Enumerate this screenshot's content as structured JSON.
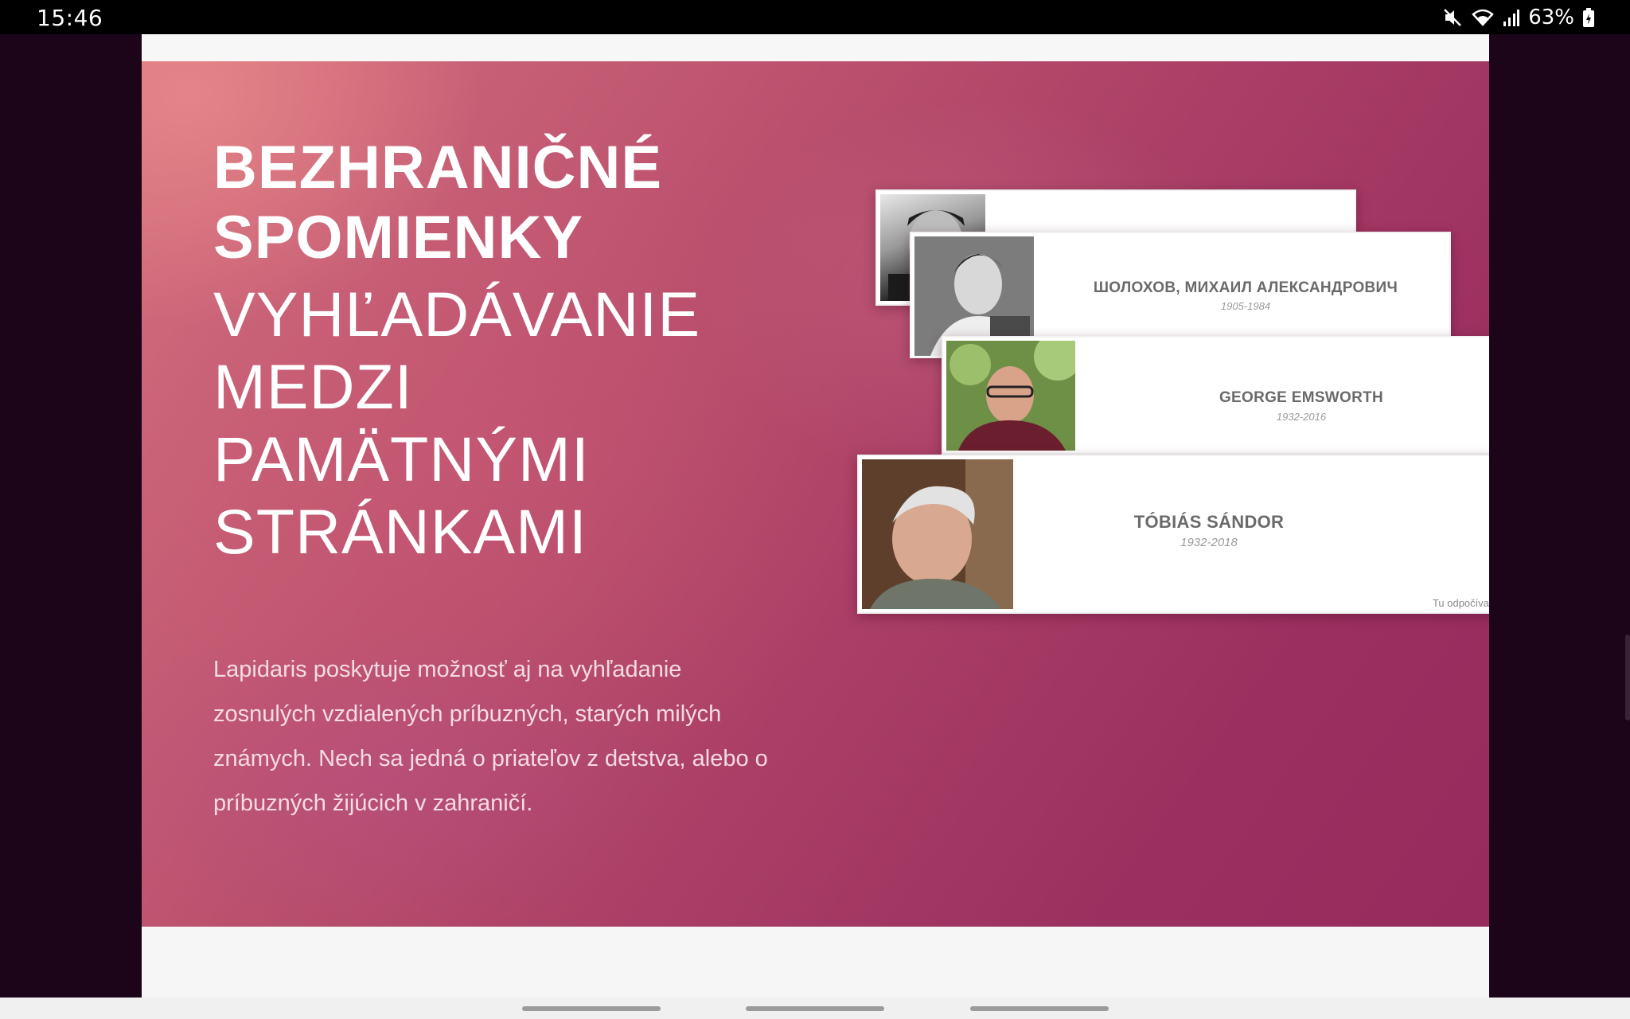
{
  "status_bar": {
    "time": "15:46",
    "battery": "63%",
    "icons": [
      "mute-icon",
      "wifi-icon",
      "signal-icon",
      "battery-icon"
    ]
  },
  "hero": {
    "title_bold": "BEZHRANIČNÉ\nSPOMIENKY",
    "title_light": "VYHĽADÁVANIE\nMEDZI\nPAMÄTNÝMI\nSTRÁNKAMI",
    "description": "Lapidaris poskytuje možnosť aj na vyhľadanie zosnulých vzdialených príbuzných, starých milých známych. Nech sa jedná o priateľov z detstva, alebo o príbuzných žijúcich v zahraničí."
  },
  "memorial_cards": [
    {
      "name": "ШОЛОХОВ, МИХАИЛ АЛЕКСАНДРОВИЧ",
      "years": "1905-1984"
    },
    {
      "name": "GEORGE EMSWORTH",
      "years": "1932-2016"
    },
    {
      "name": "TÓBIÁS SÁNDOR",
      "years": "1932-2018",
      "footer": "Tu odpočíva"
    }
  ],
  "colors": {
    "hero_start": "#d3707e",
    "hero_end": "#952c5d",
    "sidebar": "#1c0419"
  }
}
